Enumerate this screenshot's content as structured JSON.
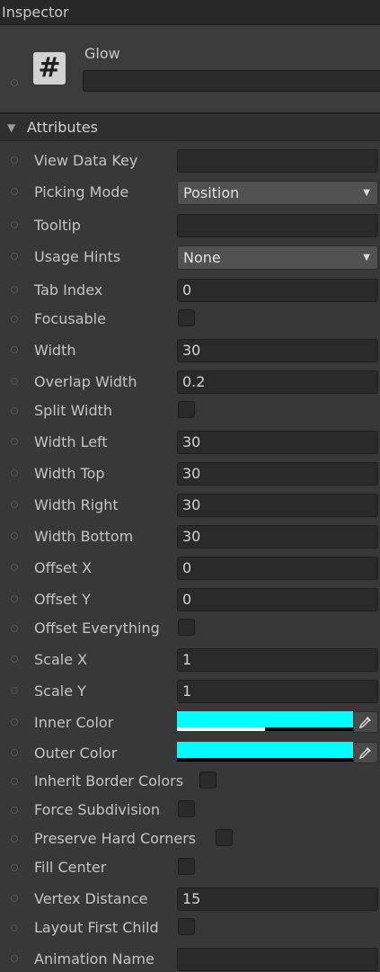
{
  "window": {
    "title": "Inspector"
  },
  "object": {
    "name": "Glow",
    "icon": "hash-icon",
    "field_value": ""
  },
  "section": {
    "title": "Attributes",
    "expanded": true
  },
  "colors": {
    "swatch": "#00ffff",
    "panel": "#383838"
  },
  "fields": {
    "view_data_key": {
      "label": "View Data Key",
      "value": ""
    },
    "picking_mode": {
      "label": "Picking Mode",
      "value": "Position"
    },
    "tooltip": {
      "label": "Tooltip",
      "value": ""
    },
    "usage_hints": {
      "label": "Usage Hints",
      "value": "None"
    },
    "tab_index": {
      "label": "Tab Index",
      "value": "0"
    },
    "focusable": {
      "label": "Focusable",
      "checked": false
    },
    "width": {
      "label": "Width",
      "value": "30"
    },
    "overlap_width": {
      "label": "Overlap Width",
      "value": "0.2"
    },
    "split_width": {
      "label": "Split Width",
      "checked": false
    },
    "width_left": {
      "label": "Width Left",
      "value": "30"
    },
    "width_top": {
      "label": "Width Top",
      "value": "30"
    },
    "width_right": {
      "label": "Width Right",
      "value": "30"
    },
    "width_bottom": {
      "label": "Width Bottom",
      "value": "30"
    },
    "offset_x": {
      "label": "Offset X",
      "value": "0"
    },
    "offset_y": {
      "label": "Offset Y",
      "value": "0"
    },
    "offset_everything": {
      "label": "Offset Everything",
      "checked": false
    },
    "scale_x": {
      "label": "Scale X",
      "value": "1"
    },
    "scale_y": {
      "label": "Scale Y",
      "value": "1"
    },
    "inner_color": {
      "label": "Inner Color",
      "color": "#00ffff",
      "alpha": 0.5
    },
    "outer_color": {
      "label": "Outer Color",
      "color": "#00ffff",
      "alpha": 0.0
    },
    "inherit_border_colors": {
      "label": "Inherit Border Colors",
      "checked": false
    },
    "force_subdivision": {
      "label": "Force Subdivision",
      "checked": false
    },
    "preserve_hard_corners": {
      "label": "Preserve Hard Corners",
      "checked": false
    },
    "fill_center": {
      "label": "Fill Center",
      "checked": false
    },
    "vertex_distance": {
      "label": "Vertex Distance",
      "value": "15"
    },
    "layout_first_child": {
      "label": "Layout First Child",
      "checked": false
    },
    "animation_name": {
      "label": "Animation Name",
      "value": ""
    }
  }
}
